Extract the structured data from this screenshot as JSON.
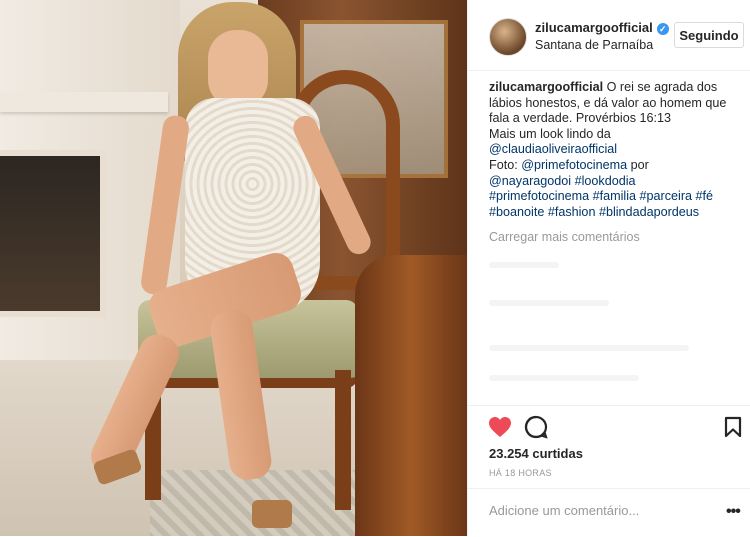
{
  "post": {
    "username": "zilucamargoofficial",
    "location": "Santana de Parnaíba",
    "follow_label": "Seguindo"
  },
  "caption": {
    "username": "zilucamargoofficial",
    "text_1": "O rei se agrada dos lábios honestos, e dá valor ao homem que fala a verdade. Provérbios 16:13",
    "text_2": "Mais um look lindo da",
    "mention_1": "@claudiaoliveiraofficial",
    "text_3": "Foto:",
    "mention_2": "@primefotocinema",
    "text_4": "por",
    "mention_3": "@nayaragodoi",
    "hashtag_1": "#lookdodia",
    "hashtag_2": "#primefotocinema",
    "hashtag_3": "#familia",
    "hashtag_4": "#parceira",
    "hashtag_5": "#fé",
    "hashtag_6": "#boanoite",
    "hashtag_7": "#fashion",
    "hashtag_8": "#blindadapordeus"
  },
  "load_more_label": "Carregar mais comentários",
  "actions": {
    "like_icon": "heart-icon",
    "comment_icon": "comment-icon",
    "save_icon": "bookmark-icon",
    "like_color": "#ed4956"
  },
  "likes_label": "23.254 curtidas",
  "timestamp": "HÁ 18 HORAS",
  "comment_placeholder": "Adicione um comentário...",
  "more_label": "•••"
}
